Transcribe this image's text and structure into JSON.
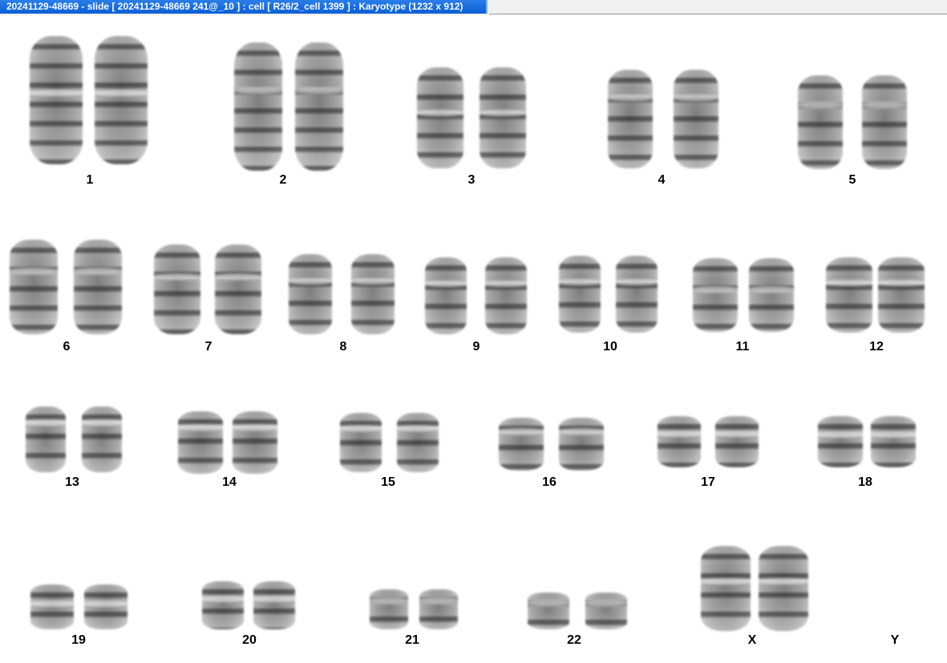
{
  "window": {
    "title": "20241129-48669 - slide [ 20241129-48669 241@_10 ] : cell [ R26/2_cell 1399 ] : Karyotype  (1232 x 912)"
  },
  "karyotype": {
    "labels": [
      "1",
      "2",
      "3",
      "4",
      "5",
      "6",
      "7",
      "8",
      "9",
      "10",
      "11",
      "12",
      "13",
      "14",
      "15",
      "16",
      "17",
      "18",
      "19",
      "20",
      "21",
      "22",
      "X",
      "Y"
    ]
  }
}
